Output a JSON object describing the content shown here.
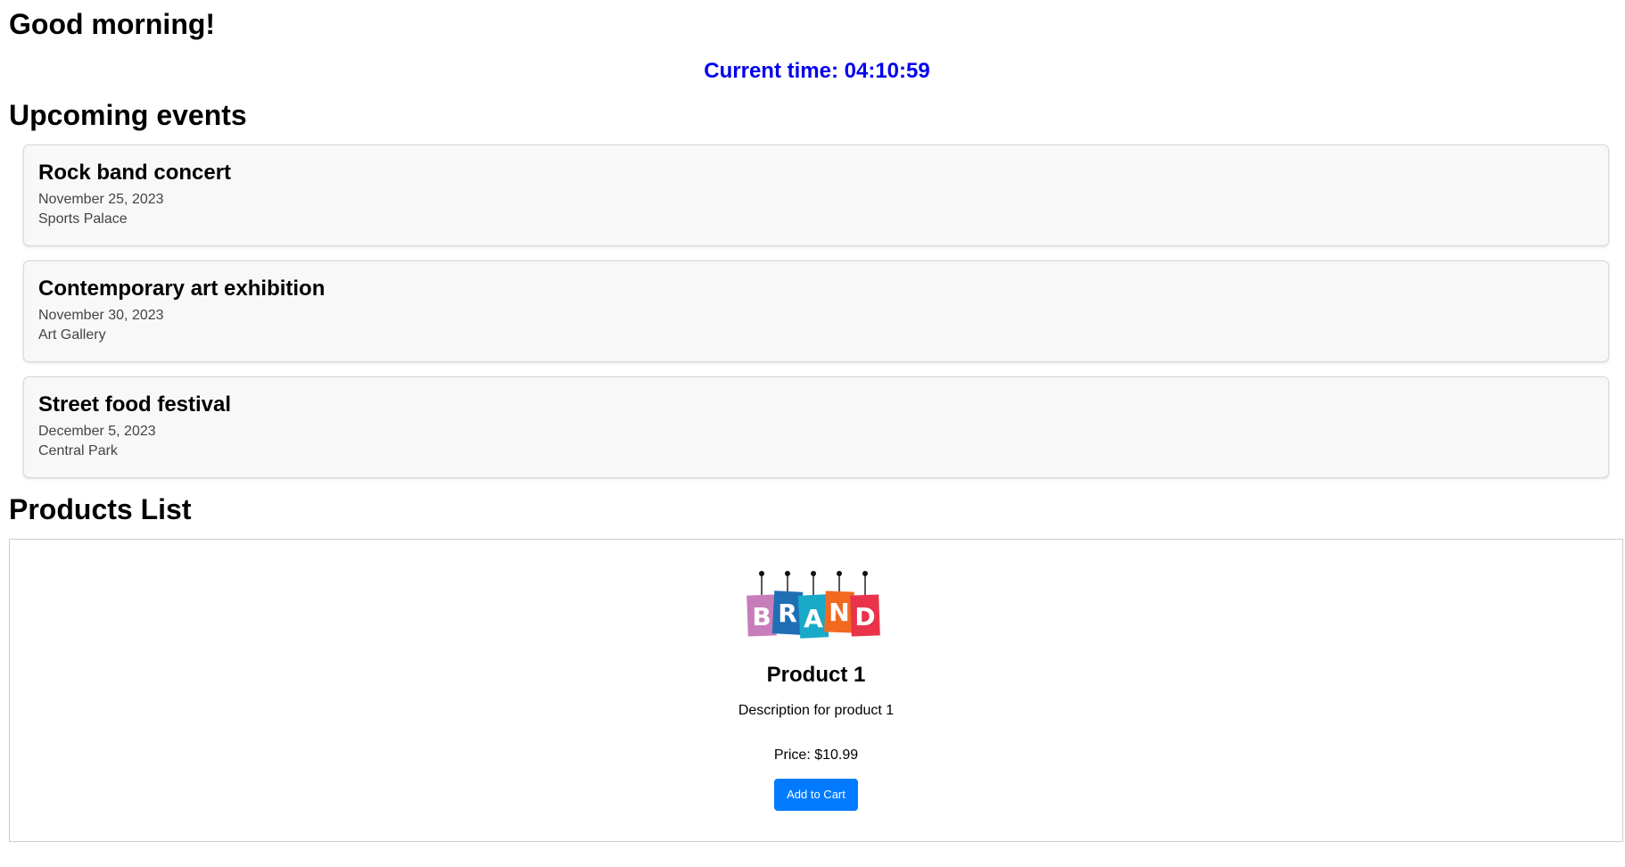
{
  "greeting": "Good morning!",
  "clock": {
    "label": "Current time: 04:10:59",
    "color": "#0000ee"
  },
  "events": {
    "title": "Upcoming events",
    "items": [
      {
        "title": "Rock band concert",
        "date": "November 25, 2023",
        "location": "Sports Palace"
      },
      {
        "title": "Contemporary art exhibition",
        "date": "November 30, 2023",
        "location": "Art Gallery"
      },
      {
        "title": "Street food festival",
        "date": "December 5, 2023",
        "location": "Central Park"
      }
    ]
  },
  "products": {
    "title": "Products List",
    "items": [
      {
        "logo_icon": "brand-logo-icon",
        "logo_letters": [
          "B",
          "R",
          "A",
          "N",
          "D"
        ],
        "logo_colors": [
          "#c77dba",
          "#1f6fb5",
          "#19a9c9",
          "#f26a21",
          "#e8334a"
        ],
        "name": "Product 1",
        "description": "Description for product 1",
        "price": "Price: $10.99",
        "button_label": "Add to Cart",
        "button_color": "#007bff"
      }
    ]
  }
}
